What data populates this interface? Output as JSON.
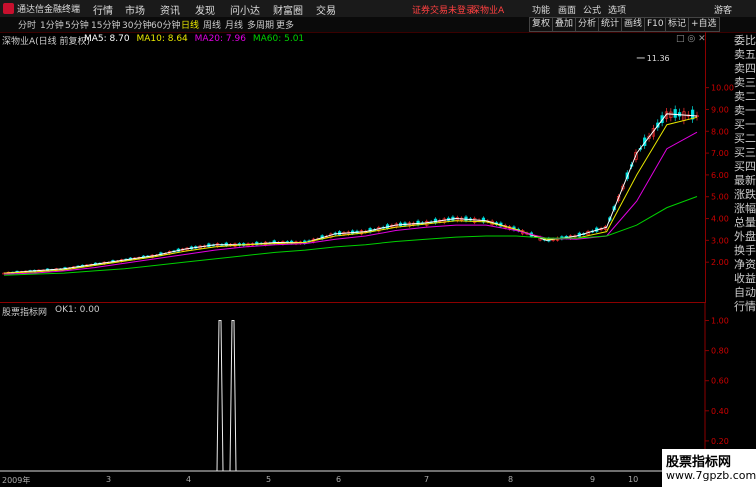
{
  "app": {
    "title": "通达信金融终端"
  },
  "menu": [
    "行情",
    "市场",
    "资讯",
    "发现",
    "问小达",
    "财富圈",
    "交易"
  ],
  "warning": "证券交易未登录",
  "stock_name": "深物业A",
  "right_menu": [
    "功能",
    "画面",
    "公式",
    "选项",
    "游客"
  ],
  "periods": [
    "分时",
    "1分钟",
    "5分钟",
    "15分钟",
    "30分钟",
    "60分钟",
    "日线",
    "周线",
    "月线",
    "多周期",
    "更多"
  ],
  "active_period": "日线",
  "right_buttons": [
    "复权",
    "叠加",
    "分析",
    "统计",
    "画线",
    "F10",
    "标记",
    "+自选"
  ],
  "main": {
    "label": "深物业A(日线 前复权)",
    "ma5": "MA5: 8.70",
    "ma10": "MA10: 8.64",
    "ma20": "MA20: 7.96",
    "ma60": "MA60: 5.01",
    "max_label": "11.36",
    "y_ticks": [
      "10.00",
      "9.00",
      "8.00",
      "7.00",
      "6.00",
      "5.00",
      "4.00",
      "3.00",
      "2.00"
    ]
  },
  "indicator": {
    "label": "股票指标网",
    "ok_label": "OK1: 0.00",
    "y_ticks": [
      "1.00",
      "0.80",
      "0.60",
      "0.40",
      "0.20"
    ]
  },
  "x_labels": [
    "2009年",
    "3",
    "4",
    "5",
    "6",
    "7",
    "8",
    "9",
    "10"
  ],
  "right_panel": [
    "委比",
    "卖五",
    "卖四",
    "卖三",
    "卖二",
    "卖一",
    "买一",
    "买二",
    "买三",
    "买四",
    "最新",
    "涨跌",
    "涨幅",
    "总量",
    "外盘",
    "换手",
    "净资",
    "收益",
    "自动",
    "行情"
  ],
  "watermark": {
    "line1": "股票指标网",
    "line2": "www.7gpzb.com"
  },
  "colors": {
    "up": "#ff3030",
    "down": "#00e0e0",
    "ma5": "#ffffff",
    "ma10": "#e8e800",
    "ma20": "#e000e0",
    "ma60": "#00d000",
    "axis": "#8b0000"
  },
  "chart_data": [
    {
      "type": "line",
      "title": "深物业A(日线 前复权)",
      "series": [
        {
          "name": "MA5",
          "values": [
            1.5,
            1.6,
            1.7,
            1.9,
            2.1,
            2.3,
            2.6,
            2.8,
            2.8,
            2.9,
            2.9,
            3.3,
            3.4,
            3.7,
            3.8,
            4.0,
            3.9,
            3.5,
            3.0,
            3.2,
            3.6,
            7.0,
            8.8,
            8.7
          ]
        },
        {
          "name": "MA10",
          "values": [
            1.5,
            1.55,
            1.65,
            1.85,
            2.05,
            2.25,
            2.5,
            2.7,
            2.8,
            2.85,
            2.9,
            3.2,
            3.35,
            3.6,
            3.75,
            3.9,
            3.85,
            3.5,
            3.05,
            3.1,
            3.4,
            6.0,
            8.3,
            8.64
          ]
        },
        {
          "name": "MA20",
          "values": [
            1.45,
            1.5,
            1.6,
            1.75,
            1.95,
            2.15,
            2.35,
            2.55,
            2.7,
            2.8,
            2.85,
            3.05,
            3.2,
            3.45,
            3.6,
            3.7,
            3.7,
            3.45,
            3.1,
            3.05,
            3.2,
            4.8,
            7.2,
            7.96
          ]
        },
        {
          "name": "MA60",
          "values": [
            1.4,
            1.45,
            1.5,
            1.6,
            1.7,
            1.85,
            2.0,
            2.15,
            2.3,
            2.45,
            2.55,
            2.7,
            2.8,
            2.95,
            3.05,
            3.15,
            3.2,
            3.2,
            3.1,
            3.1,
            3.2,
            3.7,
            4.5,
            5.01
          ]
        }
      ],
      "ylim": [
        1.0,
        12.0
      ],
      "max_annotation": 11.36
    },
    {
      "type": "line",
      "title": "股票指标网",
      "series": [
        {
          "name": "OK1",
          "values": [
            0,
            0,
            0,
            0,
            0,
            0,
            0,
            0,
            0,
            0,
            0,
            0,
            0,
            0,
            0,
            0,
            0,
            0,
            0,
            0,
            0,
            0,
            0,
            0
          ]
        }
      ],
      "spikes": [
        {
          "x_label": "4",
          "value": 1.0
        },
        {
          "x_label": "4",
          "value": 1.0
        }
      ],
      "ylim": [
        0,
        1.05
      ]
    }
  ]
}
